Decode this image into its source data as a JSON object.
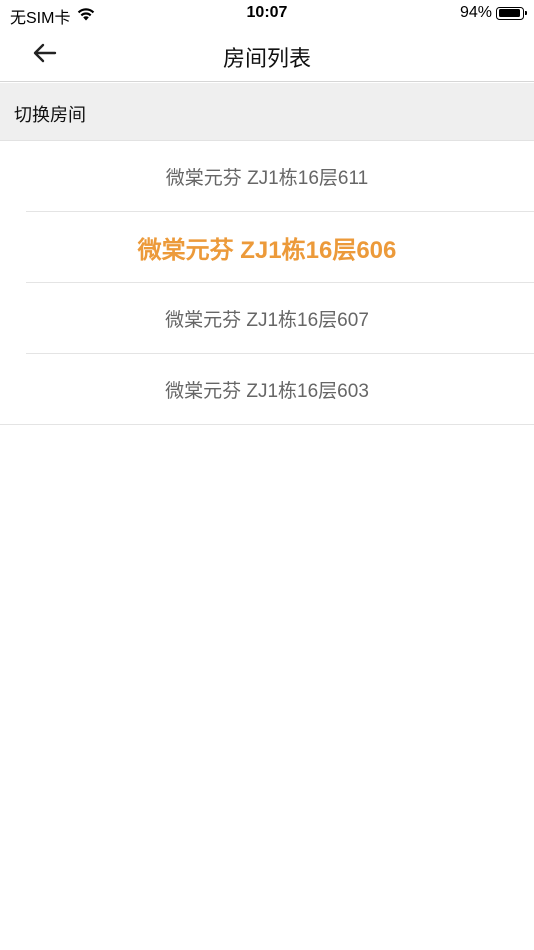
{
  "status_bar": {
    "carrier": "无SIM卡",
    "time": "10:07",
    "battery_percent": "94%",
    "battery_level": 0.94,
    "wifi_icon": "wifi-icon"
  },
  "nav": {
    "title": "房间列表",
    "back_icon": "arrow-left-icon"
  },
  "section": {
    "title": "切换房间"
  },
  "rooms": [
    {
      "label": "微棠元芬 ZJ1栋16层611",
      "selected": false
    },
    {
      "label": "微棠元芬 ZJ1栋16层606",
      "selected": true
    },
    {
      "label": "微棠元芬 ZJ1栋16层607",
      "selected": false
    },
    {
      "label": "微棠元芬 ZJ1栋16层603",
      "selected": false
    }
  ],
  "colors": {
    "accent": "#ec9a3a",
    "item_text": "#666666",
    "section_bg": "#efefef"
  }
}
